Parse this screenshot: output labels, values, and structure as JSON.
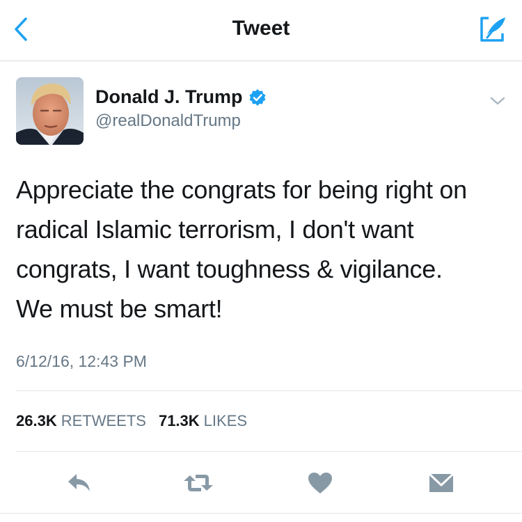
{
  "nav": {
    "title": "Tweet",
    "back_icon": "chevron-left-icon",
    "compose_icon": "compose-tweet-icon"
  },
  "tweet": {
    "author": {
      "display_name": "Donald J. Trump",
      "handle": "@realDonaldTrump",
      "verified": true
    },
    "text": "Appreciate the congrats for being right on\nradical Islamic terrorism, I don't want\ncongrats, I want toughness & vigilance.\nWe must be smart!",
    "timestamp": "6/12/16, 12:43 PM",
    "stats": {
      "retweets_count": "26.3K",
      "retweets_label": "RETWEETS",
      "likes_count": "71.3K",
      "likes_label": "LIKES"
    }
  },
  "actions": [
    "reply-icon",
    "retweet-icon",
    "like-icon",
    "direct-message-icon"
  ],
  "colors": {
    "accent": "#1da1f2",
    "text": "#14171a",
    "secondary_text": "#657786",
    "action_icon": "#8899a6",
    "divider": "#e1e8ed"
  }
}
